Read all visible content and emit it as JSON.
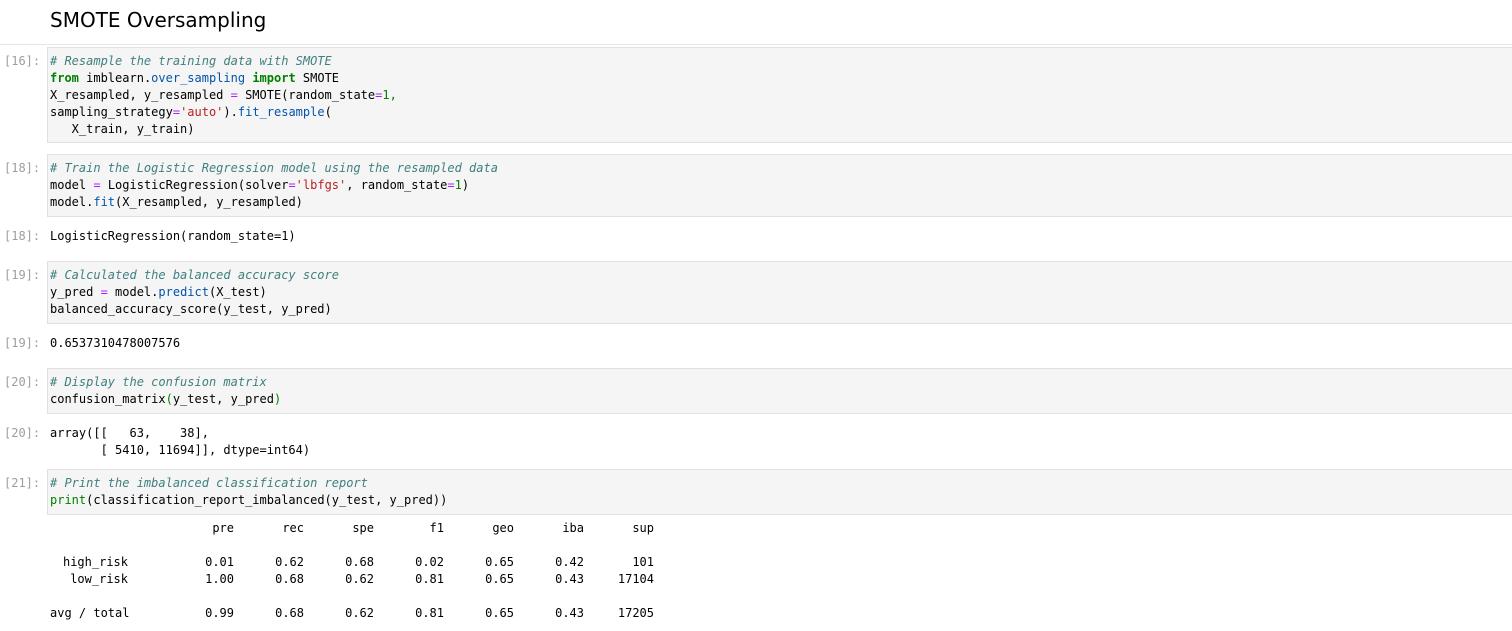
{
  "heading": "SMOTE Oversampling",
  "cells": [
    {
      "prompt": "[16]:",
      "code_lines": [
        [
          {
            "t": "# Resample the training data with SMOTE",
            "c": "c"
          }
        ],
        [
          {
            "t": "from",
            "c": "k"
          },
          {
            "t": " imblearn",
            "c": ""
          },
          {
            "t": ".",
            "c": ""
          },
          {
            "t": "over_sampling",
            "c": "m"
          },
          {
            "t": " ",
            "c": ""
          },
          {
            "t": "import",
            "c": "k"
          },
          {
            "t": " SMOTE",
            "c": ""
          }
        ],
        [
          {
            "t": "X_resampled, y_resampled ",
            "c": ""
          },
          {
            "t": "=",
            "c": "o"
          },
          {
            "t": " SMOTE(random_state",
            "c": ""
          },
          {
            "t": "=",
            "c": "o"
          },
          {
            "t": "1,",
            "c": "n"
          }
        ],
        [
          {
            "t": "sampling_strategy",
            "c": ""
          },
          {
            "t": "=",
            "c": "o"
          },
          {
            "t": "'auto'",
            "c": "s"
          },
          {
            "t": ").",
            "c": ""
          },
          {
            "t": "fit_resample",
            "c": "m"
          },
          {
            "t": "(",
            "c": ""
          }
        ],
        [
          {
            "t": "   X_train, y_train)",
            "c": ""
          }
        ]
      ]
    },
    {
      "prompt": "[18]:",
      "code_lines": [
        [
          {
            "t": "# Train the Logistic Regression model using the resampled data",
            "c": "c"
          }
        ],
        [
          {
            "t": "model ",
            "c": ""
          },
          {
            "t": "=",
            "c": "o"
          },
          {
            "t": " LogisticRegression(solver",
            "c": ""
          },
          {
            "t": "=",
            "c": "o"
          },
          {
            "t": "'lbfgs'",
            "c": "s"
          },
          {
            "t": ", random_state",
            "c": ""
          },
          {
            "t": "=",
            "c": "o"
          },
          {
            "t": "1",
            "c": "n"
          },
          {
            "t": ")",
            "c": ""
          }
        ],
        [
          {
            "t": "model",
            "c": ""
          },
          {
            "t": ".",
            "c": ""
          },
          {
            "t": "fit",
            "c": "m"
          },
          {
            "t": "(X_resampled, y_resampled)",
            "c": ""
          }
        ]
      ],
      "output_prompt": "[18]:",
      "output": "LogisticRegression(random_state=1)"
    },
    {
      "prompt": "[19]:",
      "code_lines": [
        [
          {
            "t": "# Calculated the balanced accuracy score",
            "c": "c"
          }
        ],
        [
          {
            "t": "y_pred ",
            "c": ""
          },
          {
            "t": "=",
            "c": "o"
          },
          {
            "t": " model",
            "c": ""
          },
          {
            "t": ".",
            "c": ""
          },
          {
            "t": "predict",
            "c": "m"
          },
          {
            "t": "(X_test)",
            "c": ""
          }
        ],
        [
          {
            "t": "balanced_accuracy_score(y_test, y_pred)",
            "c": ""
          }
        ]
      ],
      "output_prompt": "[19]:",
      "output": "0.6537310478007576"
    },
    {
      "prompt": "[20]:",
      "code_lines": [
        [
          {
            "t": "# Display the confusion matrix",
            "c": "c"
          }
        ],
        [
          {
            "t": "confusion_matrix",
            "c": ""
          },
          {
            "t": "(",
            "c": "n"
          },
          {
            "t": "y_test, y_pred",
            "c": ""
          },
          {
            "t": ")",
            "c": "n"
          }
        ]
      ],
      "output_prompt": "[20]:",
      "output": "array([[   63,    38],\n       [ 5410, 11694]], dtype=int64)"
    },
    {
      "prompt": "[21]:",
      "code_lines": [
        [
          {
            "t": "# Print the imbalanced classification report",
            "c": "c"
          }
        ],
        [
          {
            "t": "print",
            "c": "n"
          },
          {
            "t": "(classification_report_imbalanced(y_test, y_pred))",
            "c": ""
          }
        ]
      ]
    }
  ],
  "report": {
    "headers": [
      "pre",
      "rec",
      "spe",
      "f1",
      "geo",
      "iba",
      "sup"
    ],
    "rows": [
      {
        "label": "high_risk",
        "values": [
          "0.01",
          "0.62",
          "0.68",
          "0.02",
          "0.65",
          "0.42",
          "101"
        ]
      },
      {
        "label": "low_risk",
        "values": [
          "1.00",
          "0.68",
          "0.62",
          "0.81",
          "0.65",
          "0.43",
          "17104"
        ]
      },
      {
        "label": "avg / total",
        "values": [
          "0.99",
          "0.68",
          "0.62",
          "0.81",
          "0.65",
          "0.43",
          "17205"
        ]
      }
    ]
  }
}
